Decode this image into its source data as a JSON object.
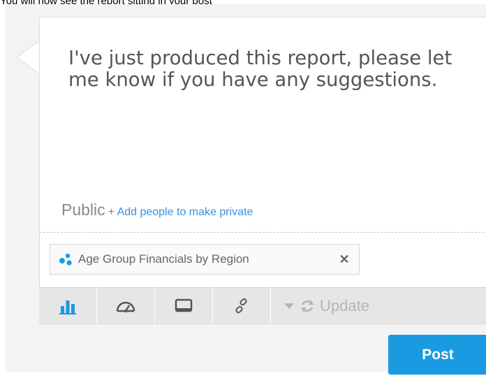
{
  "caption": "You will now see the report sitting in your post",
  "message": "I've just produced this report, please let me know if you have any suggestions.",
  "visibility": {
    "label": "Public",
    "link": "+ Add people to make private"
  },
  "attachment": {
    "icon": "bubble-chart-icon",
    "label": "Age Group Financials by Region",
    "remove_icon": "close-icon"
  },
  "toolbar": {
    "items": [
      {
        "icon": "bar-chart-icon",
        "active": true
      },
      {
        "icon": "dashboard-gauge-icon",
        "active": false
      },
      {
        "icon": "monitor-icon",
        "active": false
      },
      {
        "icon": "link-icon",
        "active": false
      }
    ],
    "update_label": "Update"
  },
  "post_label": "Post",
  "colors": {
    "accent": "#1a9ae0",
    "link": "#3d8fd6",
    "text": "#555555"
  }
}
